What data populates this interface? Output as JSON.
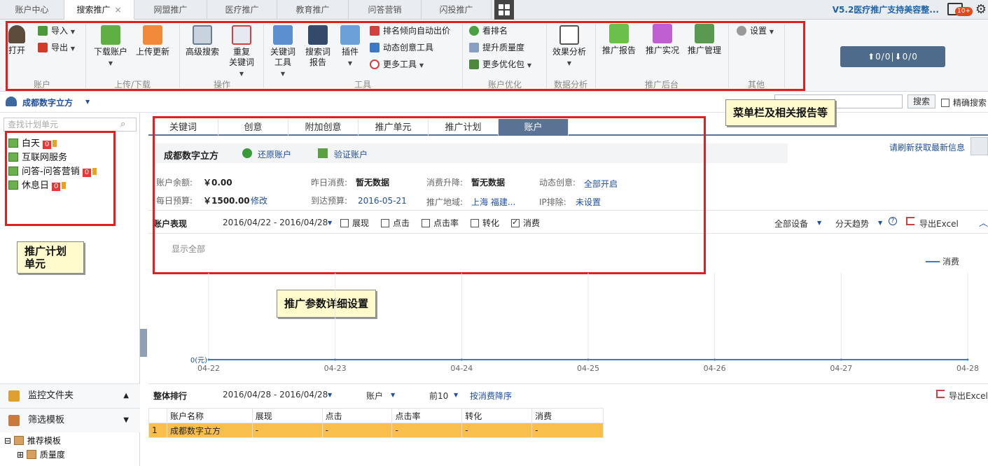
{
  "top_tabs": [
    "账户中心",
    "搜索推广",
    "网盟推广",
    "医疗推广",
    "教育推广",
    "问答营销",
    "闪投推广"
  ],
  "top_tab_close": "×",
  "version_text": "V5.2医疗推广支持美容整...",
  "msg_badge": "10+",
  "ribbon": {
    "open": "打开",
    "import": "导入",
    "export": "导出",
    "download_account": "下载账户",
    "upload_update": "上传更新",
    "advanced_search": "高级搜索",
    "dup_keywords_1": "重复",
    "dup_keywords_2": "关键词",
    "keyword_tool_1": "关键词",
    "keyword_tool_2": "工具",
    "search_report_1": "搜索词",
    "search_report_2": "报告",
    "plugins": "插件",
    "rank_bid": "排名倾向自动出价",
    "dyn_creative_tool": "动态创意工具",
    "more_tools": "更多工具",
    "view_rank": "看排名",
    "quality": "提升质量度",
    "more_opt": "更多优化包",
    "effect_analysis": "效果分析",
    "promo_report": "推广报告",
    "promo_live": "推广实况",
    "promo_manage": "推广管理",
    "settings": "设置",
    "groups": {
      "account": "账户",
      "updown": "上传/下载",
      "ops": "操作",
      "tools": "工具",
      "optimize": "账户优化",
      "data": "数据分析",
      "backend": "推广后台",
      "other": "其他"
    },
    "counter": "⬆0/0|⬇0/0"
  },
  "account_name": "成都数字立方",
  "search_btn": "搜索",
  "exact_search": "精确搜索",
  "search_plan_placeholder": "查找计划单元",
  "tree": [
    {
      "name": "白天",
      "badge": "0"
    },
    {
      "name": "互联网服务",
      "badge": ""
    },
    {
      "name": "问答-问答营销",
      "badge": "0"
    },
    {
      "name": "休息日",
      "badge": "0"
    }
  ],
  "notes": {
    "menu": "菜单栏及相关报告等",
    "plan_1": "推广计划",
    "plan_2": "单元",
    "params": "推广参数详细设置"
  },
  "left_bottom": {
    "monitor": "监控文件夹",
    "filter": "筛选模板",
    "recommend": "推荐模板",
    "quality": "质量度"
  },
  "main_tabs": [
    "关键词",
    "创意",
    "附加创意",
    "推广单元",
    "推广计划",
    "账户"
  ],
  "account_panel": {
    "title": "成都数字立方",
    "restore": "还原账户",
    "verify": "验证账户",
    "refresh": "请刷新获取最新信息",
    "balance_label": "账户余额:",
    "balance": "￥0.00",
    "yesterday_label": "昨日消费:",
    "yesterday": "暂无数据",
    "change_label": "消费升降:",
    "change": "暂无数据",
    "dyn_label": "动态创意:",
    "dyn": "全部开启",
    "budget_label": "每日预算:",
    "budget": "￥1500.00",
    "modify": "修改",
    "reach_label": "到达预算:",
    "reach": "2016-05-21",
    "region_label": "推广地域:",
    "region": "上海 福建...",
    "ip_label": "IP排除:",
    "ip": "未设置"
  },
  "perf": {
    "title": "账户表现",
    "range": "2016/04/22 - 2016/04/28",
    "checks": [
      {
        "label": "展现",
        "on": false
      },
      {
        "label": "点击",
        "on": false
      },
      {
        "label": "点击率",
        "on": false
      },
      {
        "label": "转化",
        "on": false
      },
      {
        "label": "消费",
        "on": true
      }
    ],
    "devices": "全部设备",
    "trend": "分天趋势",
    "export": "导出Excel",
    "show_all": "显示全部"
  },
  "chart_data": {
    "type": "line",
    "x": [
      "04-22",
      "04-23",
      "04-24",
      "04-25",
      "04-26",
      "04-27",
      "04-28"
    ],
    "series": [
      {
        "name": "消费",
        "values": [
          0,
          0,
          0,
          0,
          0,
          0,
          0
        ]
      }
    ],
    "ylabel": "",
    "ytick": "0(元)",
    "legend": "top-right",
    "color": "#2f7fd0"
  },
  "ranking": {
    "title": "整体排行",
    "range": "2016/04/28 - 2016/04/28",
    "level": "账户",
    "top": "前10",
    "order": "按消费降序",
    "export": "导出Excel",
    "columns": [
      "",
      "账户名称",
      "展现",
      "点击",
      "点击率",
      "转化",
      "消费"
    ],
    "rows": [
      [
        "1",
        "成都数字立方",
        "-",
        "-",
        "-",
        "-",
        "-"
      ]
    ]
  }
}
